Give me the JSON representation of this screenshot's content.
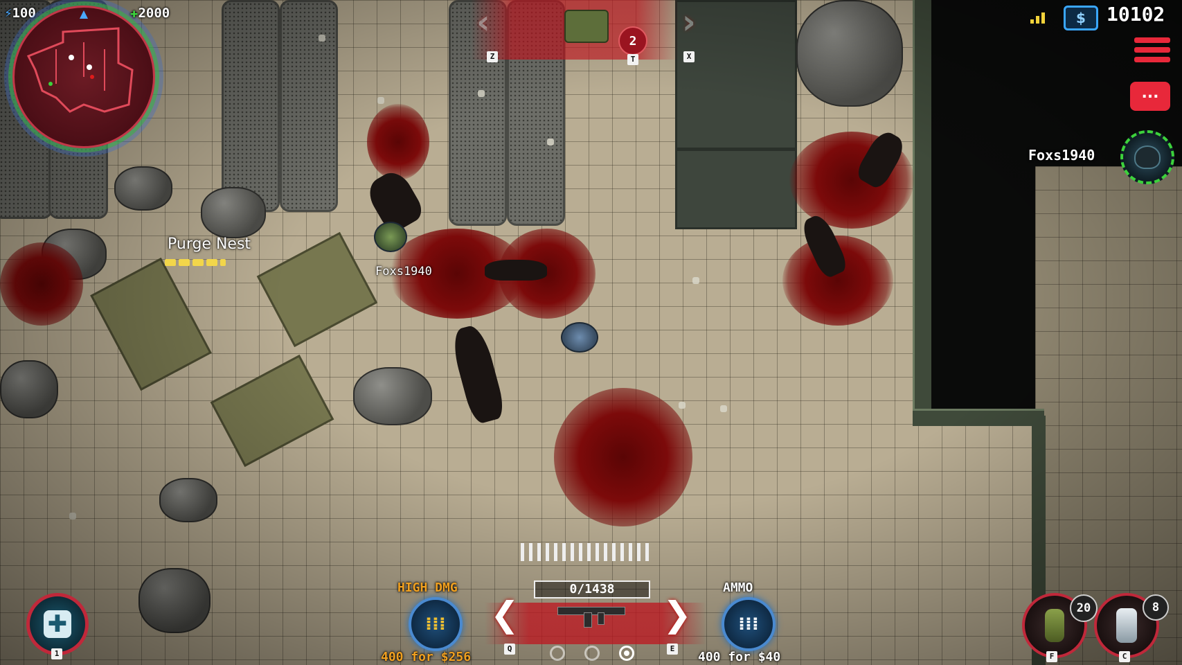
{
  "hud": {
    "energy": "100",
    "health": "2000",
    "currency_icon": "$",
    "credits": "10102",
    "signal_icon": "signal-bars-icon",
    "menu_icon": "hamburger-menu-icon",
    "chat_icon": "...",
    "colors": {
      "accent_red": "#c81e2c",
      "ammo_blue": "#4a8ad0",
      "health_green": "#3cd23c",
      "objective_yellow": "#f2d64a"
    }
  },
  "objective": {
    "title": "Purge Nest",
    "progress_segments": 5
  },
  "players": {
    "world_name": "Foxs1940",
    "roster_name": "Foxs1940"
  },
  "top_selector": {
    "count": "2",
    "keys": {
      "left": "Z",
      "middle": "T",
      "right": "X"
    }
  },
  "weapon": {
    "ammo_counter": "0/1438",
    "prev_key": "Q",
    "next_key": "E",
    "page_dots": 3,
    "active_dot": 3
  },
  "ammo_high": {
    "label": "HIGH DMG",
    "price": "400 for $256"
  },
  "ammo_normal": {
    "label": "AMMO",
    "price": "400 for $40"
  },
  "medkit": {
    "key": "1"
  },
  "grenade": {
    "count": "20",
    "key": "F"
  },
  "freeze": {
    "count": "8",
    "key": "C"
  }
}
